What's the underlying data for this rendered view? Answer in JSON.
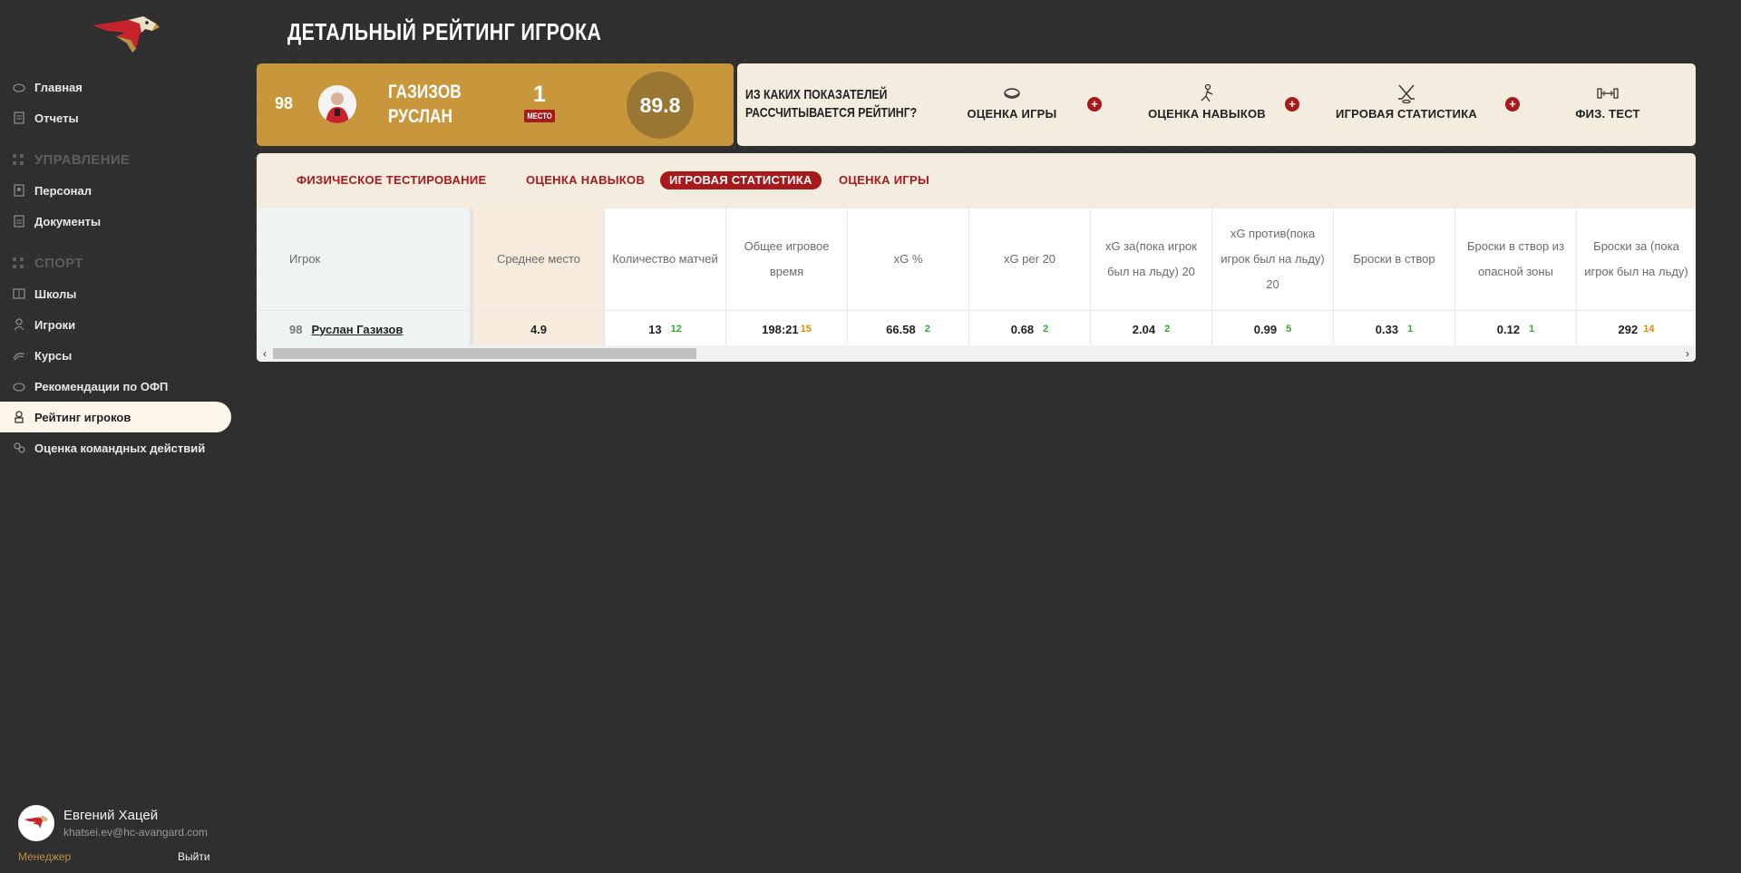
{
  "sidebar": {
    "items_top": [
      {
        "label": "Главная",
        "icon": "dashboard-icon"
      },
      {
        "label": "Отчеты",
        "icon": "report-icon"
      }
    ],
    "section_management": "УПРАВЛЕНИЕ",
    "items_management": [
      {
        "label": "Персонал",
        "icon": "staff-icon"
      },
      {
        "label": "Документы",
        "icon": "documents-icon"
      }
    ],
    "section_sport": "СПОРТ",
    "items_sport": [
      {
        "label": "Школы",
        "icon": "schools-icon"
      },
      {
        "label": "Игроки",
        "icon": "players-icon"
      },
      {
        "label": "Курсы",
        "icon": "courses-icon"
      },
      {
        "label": "Рекомендации по ОФП",
        "icon": "recommendations-icon"
      },
      {
        "label": "Рейтинг игроков",
        "icon": "rating-icon",
        "active": true
      },
      {
        "label": "Оценка командных действий",
        "icon": "team-actions-icon"
      }
    ]
  },
  "user": {
    "name": "Евгений Хацей",
    "email": "khatsei.ev@hc-avangard.com",
    "role": "Менеджер",
    "logout": "Выйти"
  },
  "page_title": "ДЕТАЛЬНЫЙ РЕЙТИНГ ИГРОКА",
  "player_card": {
    "number": "98",
    "last_name": "ГАЗИЗОВ",
    "first_name": "РУСЛАН",
    "place_value": "1",
    "place_label": "МЕСТО",
    "score": "89.8"
  },
  "info_card": {
    "question_line1": "ИЗ КАКИХ ПОКАЗАТЕЛЕЙ",
    "question_line2": "РАССЧИТЫВАЕТСЯ РЕЙТИНГ?",
    "metrics": [
      "ОЦЕНКА ИГРЫ",
      "ОЦЕНКА НАВЫКОВ",
      "ИГРОВАЯ СТАТИСТИКА",
      "ФИЗ. ТЕСТ"
    ],
    "plus": "+"
  },
  "tabs": [
    {
      "label": "ФИЗИЧЕСКОЕ ТЕСТИРОВАНИЕ"
    },
    {
      "label": "ОЦЕНКА НАВЫКОВ"
    },
    {
      "label": "ИГРОВАЯ СТАТИСТИКА",
      "active": true
    },
    {
      "label": "ОЦЕНКА ИГРЫ"
    }
  ],
  "table": {
    "headers": [
      "Игрок",
      "Среднее место",
      "Количество матчей",
      "Общее игровое время",
      "xG %",
      "xG per 20",
      "xG за(пока игрок был на льду) 20",
      "xG против(пока игрок был на льду) 20",
      "Броски в створ",
      "Броски в створ из опасной зоны",
      "Броски за (пока игрок был на льду)"
    ],
    "row": {
      "number": "98",
      "player": "Руслан Газизов",
      "avg_place": "4.9",
      "cells": [
        {
          "value": "13",
          "rank": "12",
          "rank_color": "#2fab2f"
        },
        {
          "value": "198:21",
          "rank": "15",
          "rank_color": "#e08a00"
        },
        {
          "value": "66.58",
          "rank": "2",
          "rank_color": "#2fab2f"
        },
        {
          "value": "0.68",
          "rank": "2",
          "rank_color": "#2fab2f"
        },
        {
          "value": "2.04",
          "rank": "2",
          "rank_color": "#2fab2f"
        },
        {
          "value": "0.99",
          "rank": "5",
          "rank_color": "#2fab2f"
        },
        {
          "value": "0.33",
          "rank": "1",
          "rank_color": "#2fab2f"
        },
        {
          "value": "0.12",
          "rank": "1",
          "rank_color": "#2fab2f"
        },
        {
          "value": "292",
          "rank": "14",
          "rank_color": "#e08a00"
        }
      ]
    }
  },
  "colors": {
    "brand_red": "#a8191c",
    "gold": "#c8973c",
    "cream": "#f5ece0"
  }
}
